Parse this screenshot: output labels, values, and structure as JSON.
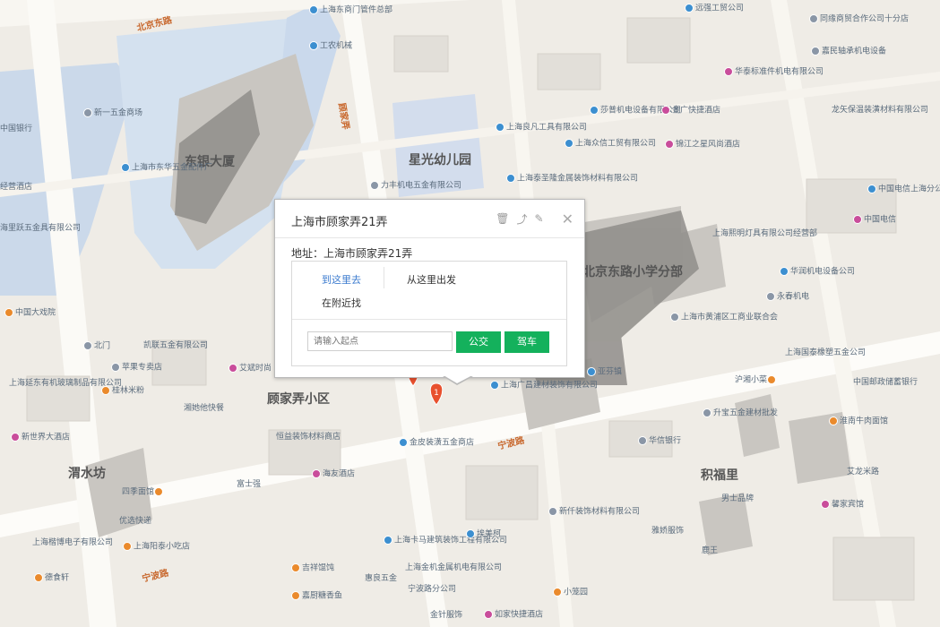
{
  "popup": {
    "title": "上海市顾家弄21弄",
    "address": "地址：上海市顾家弄21弄",
    "to_here": "到这里去",
    "from_here": "从这里出发",
    "nearby": "在附近找",
    "input_placeholder": "请输入起点",
    "bus_button": "公交",
    "drive_button": "驾车",
    "icons": [
      "delete-icon",
      "share-icon",
      "edit-icon",
      "close-icon"
    ]
  },
  "map": {
    "areas": [
      "东银大厦",
      "星光幼儿园",
      "北京东路小学分部",
      "顾家弄小区",
      "渭水坊",
      "积福里"
    ],
    "roads": [
      "北京东路",
      "宁波路",
      "宁波路",
      "顾家弄"
    ],
    "pois": [
      "上海东商门管件总部",
      "工农机械",
      "新一五金商场",
      "中国银行",
      "上海市东华五金配件厂",
      "经营酒店",
      "海里跃五金具有限公司",
      "中国大戏院",
      "北门",
      "凯联五金有限公司",
      "苹果专卖店",
      "上海延东有机玻璃制品有限公司",
      "桂林米粉",
      "湘她他快餐",
      "恒益装饰材料商店",
      "新世界大酒店",
      "艾斌时尚",
      "金皮装潢五金商店",
      "海友酒店",
      "富士强",
      "四季面馆",
      "优选快递",
      "上海楷博电子有限公司",
      "上海阳泰小吃店",
      "德食轩",
      "吉祥馄饨",
      "嘉厨糖香鱼",
      "惠良五金",
      "上海金机金属机电有限公司",
      "宁波路分公司",
      "金针服饰",
      "如家快捷酒店",
      "小笼园",
      "上海卡马建筑装饰工程有限公司",
      "埃美柯",
      "新仟装饰材料有限公司",
      "雅娇服饰",
      "鹿王",
      "积福里",
      "男士品牌",
      "馨家宾馆",
      "艾龙米路",
      "永春机电",
      "华润机电设备公司",
      "上海市黄浦区工商业联合会",
      "上海国泰橡塑五金公司",
      "中国邮政储蓄银行",
      "沪湘小菜",
      "升宝五金建材批发",
      "淮南牛肉面馆",
      "华信银行",
      "上海熙明灯具有限公司经营部",
      "中国电信上海分公司中区局",
      "中国电信",
      "远强工贸公司",
      "同缘商贸合作公司十分店",
      "嘉民轴承机电设备",
      "华泰标准件机电有限公司",
      "龙矢保温装潢材料有限公司",
      "莎普机电设备有限公司",
      "金广快捷酒店",
      "上海良凡工具有限公司",
      "上海众信工贸有限公司",
      "锦江之星风尚酒店",
      "力丰机电五金有限公司",
      "上海泰圣隆金属装饰材料有限公司",
      "上海广昌建材装饰有限公司",
      "亚芬镇"
    ]
  },
  "colors": {
    "bus_green": "#14b15c",
    "link_blue": "#3d7ccf",
    "road_orange": "#c8672c",
    "marker_red": "#e8502e"
  }
}
